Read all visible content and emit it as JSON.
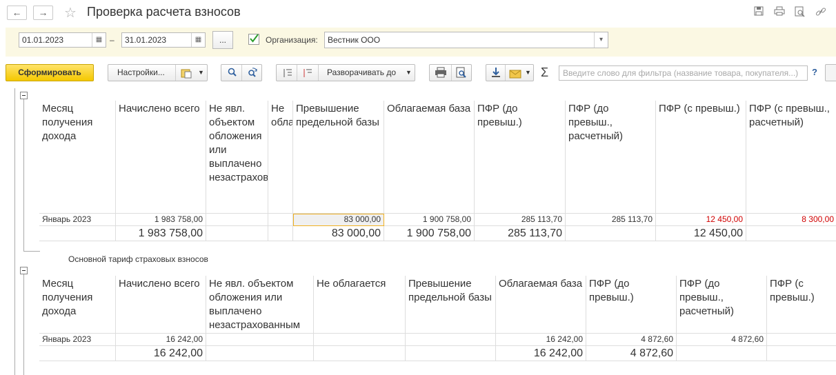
{
  "window": {
    "title": "Проверка расчета взносов",
    "back_icon": "←",
    "forward_icon": "→"
  },
  "params": {
    "date_from": "01.01.2023",
    "date_dash": "–",
    "date_to": "31.01.2023",
    "period_button": "...",
    "org_label": "Организация:",
    "org_value": "Вестник ООО",
    "org_checked": true
  },
  "toolbar": {
    "generate": "Сформировать",
    "settings": "Настройки...",
    "expand_to": "Разворачивать до",
    "filter_placeholder": "Введите слово для фильтра (название товара, покупателя...)",
    "help": "?",
    "sum_icon": "Σ"
  },
  "table1": {
    "headers": [
      "Месяц получения дохода",
      "Начислено всего",
      "Не явл. объектом обложения или выплачено незастрахованным",
      "Не облагается",
      "Превышение предельной базы",
      "Облагаемая база",
      "ПФР (до превыш.)",
      "ПФР (до превыш., расчетный)",
      "ПФР (с превыш.)",
      "ПФР (с превыш., расчетный)"
    ],
    "row": [
      "Январь 2023",
      "1 983 758,00",
      "",
      "",
      "83 000,00",
      "1 900 758,00",
      "285 113,70",
      "285 113,70",
      "12 450,00",
      "8 300,00"
    ],
    "totals": [
      "",
      "1 983 758,00",
      "",
      "",
      "83 000,00",
      "1 900 758,00",
      "285 113,70",
      "",
      "12 450,00",
      ""
    ]
  },
  "section2_title": "Основной тариф страховых взносов",
  "table2": {
    "headers": [
      "Месяц получения дохода",
      "Начислено всего",
      "Не явл. объектом обложения или выплачено незастрахованным",
      "Не облагается",
      "Превышение предельной базы",
      "Облагаемая база",
      "ПФР (до превыш.)",
      "ПФР (до превыш., расчетный)",
      "ПФР (с превыш.)"
    ],
    "row": [
      "Январь 2023",
      "16 242,00",
      "",
      "",
      "",
      "16 242,00",
      "4 872,60",
      "4 872,60",
      ""
    ],
    "totals": [
      "",
      "16 242,00",
      "",
      "",
      "",
      "16 242,00",
      "4 872,60",
      "",
      ""
    ]
  },
  "colors": {
    "accent_button": "#f4c800",
    "param_panel": "#fbf8e3",
    "negative": "#d00000",
    "selection": "#f0b020"
  }
}
